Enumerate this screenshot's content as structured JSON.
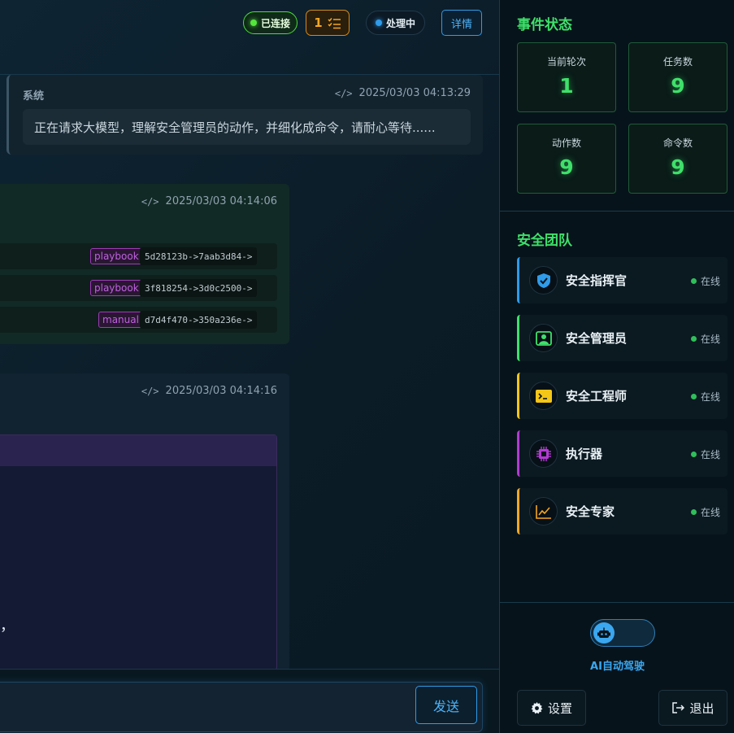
{
  "header": {
    "connection_status": "已连接",
    "task_count": "1",
    "processing_status": "处理中",
    "detail_button": "详情"
  },
  "messages": {
    "system": {
      "sender": "系统",
      "time": "2025/03/03 04:13:29",
      "text": "正在请求大模型，理解安全管理员的动作，并细化成命令，请耐心等待......"
    },
    "commands": {
      "time": "2025/03/03 04:14:06",
      "rows": [
        {
          "tag": "playbook",
          "flow": "5d28123b->7aab3d84->"
        },
        {
          "tag": "playbook",
          "flow": "3f818254->3d0c2500->"
        },
        {
          "tag": "manual",
          "flow": "d7d4f470->350a236e->"
        }
      ]
    },
    "panel": {
      "time": "2025/03/03 04:14:16",
      "trailing_text": "，"
    }
  },
  "input": {
    "send_button": "发送"
  },
  "sidebar": {
    "event_title": "事件状态",
    "stats": [
      {
        "label": "当前轮次",
        "value": "1"
      },
      {
        "label": "任务数",
        "value": "9"
      },
      {
        "label": "动作数",
        "value": "9"
      },
      {
        "label": "命令数",
        "value": "9"
      }
    ],
    "team_title": "安全团队",
    "members": [
      {
        "name": "安全指挥官",
        "status": "在线",
        "icon": "shield-check-icon",
        "color": "#2f9bea"
      },
      {
        "name": "安全管理员",
        "status": "在线",
        "icon": "admin-portrait-icon",
        "color": "#3fe06a"
      },
      {
        "name": "安全工程师",
        "status": "在线",
        "icon": "terminal-icon",
        "color": "#f5c518"
      },
      {
        "name": "执行器",
        "status": "在线",
        "icon": "chip-icon",
        "color": "#b23ad1"
      },
      {
        "name": "安全专家",
        "status": "在线",
        "icon": "trend-chart-icon",
        "color": "#f5a623"
      }
    ],
    "autopilot_label": "AI自动驾驶",
    "autopilot_on": false,
    "settings_button": "设置",
    "logout_button": "退出"
  }
}
